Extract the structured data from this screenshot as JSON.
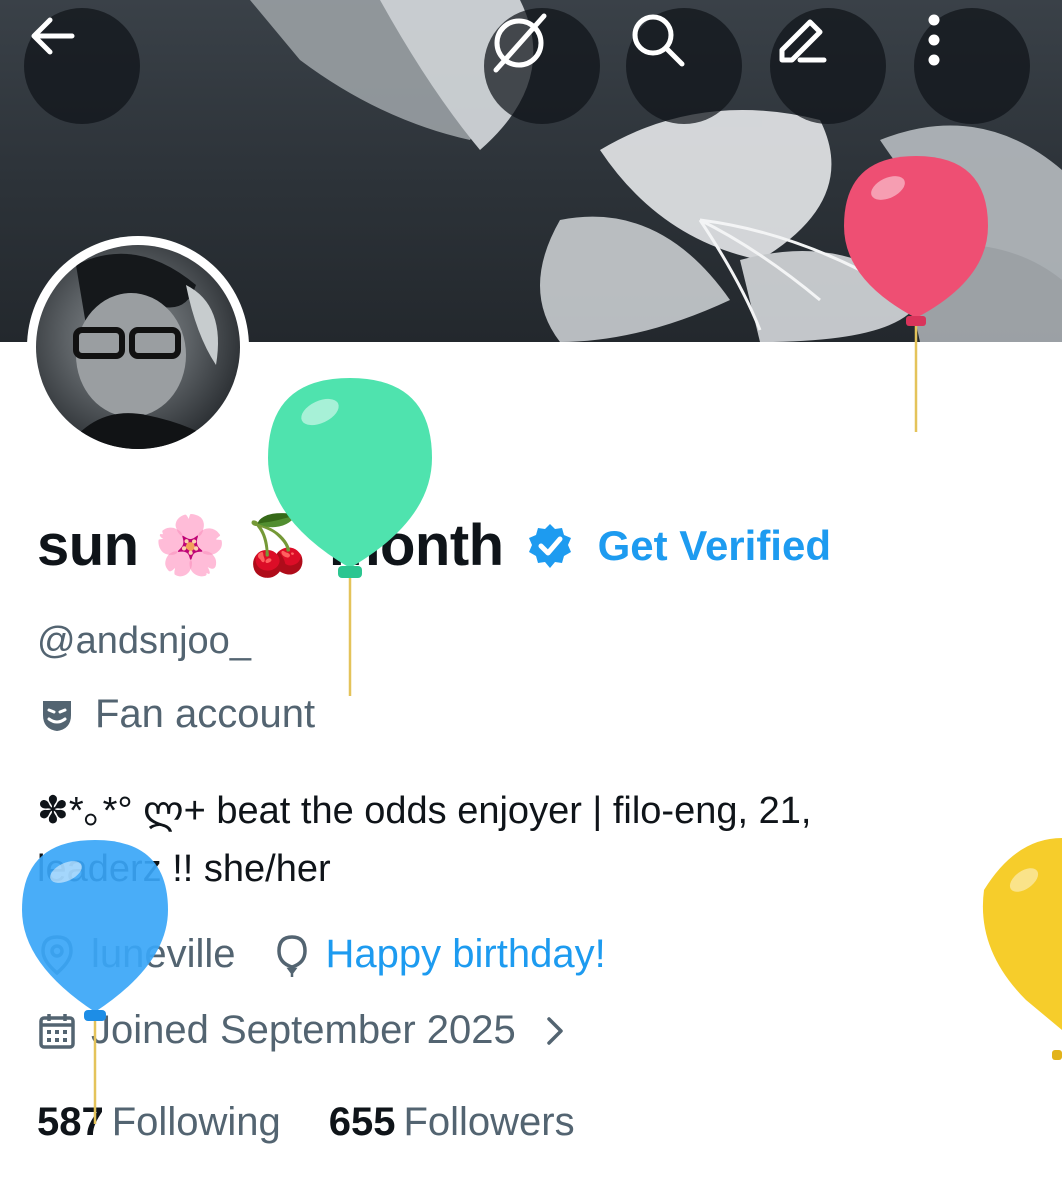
{
  "profile": {
    "display_name": "sun 🌸 🍒 month",
    "get_verified_label": "Get Verified",
    "handle": "@andsnjoo_",
    "category": "Fan account",
    "bio_line1": "✽*｡*° ლ+ beat the odds enjoyer | filo-eng, 21,",
    "bio_line2": "leaderz !! she/her",
    "location": "luneville",
    "birthday": "Happy birthday!",
    "joined": "Joined September 2025"
  },
  "stats": {
    "following_count": "587",
    "following_label": "Following",
    "followers_count": "655",
    "followers_label": "Followers"
  },
  "icons": {
    "back": "arrow-left-icon",
    "grok": "grok-icon",
    "search": "search-icon",
    "edit": "edit-icon",
    "more": "more-vertical-icon",
    "verified": "verified-badge-icon",
    "category": "theater-masks-icon",
    "location": "location-pin-icon",
    "birthday": "balloon-icon",
    "calendar": "calendar-icon",
    "chevron": "chevron-right-icon"
  },
  "colors": {
    "accent": "#1d9bf0",
    "secondary_text": "#536471",
    "primary_text": "#0f1419"
  }
}
